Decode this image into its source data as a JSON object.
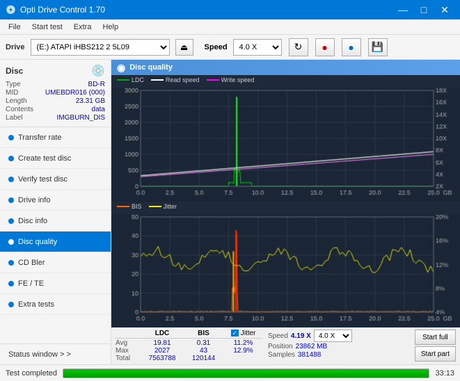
{
  "titleBar": {
    "title": "Opti Drive Control 1.70",
    "controls": [
      "—",
      "□",
      "✕"
    ]
  },
  "menuBar": {
    "items": [
      "File",
      "Start test",
      "Extra",
      "Help"
    ]
  },
  "driveBar": {
    "label": "Drive",
    "driveValue": "(E:)  ATAPI iHBS212  2 5L09",
    "speedLabel": "Speed",
    "speedValue": "4.0 X"
  },
  "disc": {
    "title": "Disc",
    "fields": [
      {
        "label": "Type",
        "value": "BD-R"
      },
      {
        "label": "MID",
        "value": "UMEBDR016 (000)"
      },
      {
        "label": "Length",
        "value": "23.31 GB"
      },
      {
        "label": "Contents",
        "value": "data"
      },
      {
        "label": "Label",
        "value": "IMGBURN_DIS"
      }
    ]
  },
  "nav": {
    "items": [
      {
        "label": "Transfer rate",
        "active": false
      },
      {
        "label": "Create test disc",
        "active": false
      },
      {
        "label": "Verify test disc",
        "active": false
      },
      {
        "label": "Drive info",
        "active": false
      },
      {
        "label": "Disc info",
        "active": false
      },
      {
        "label": "Disc quality",
        "active": true
      },
      {
        "label": "CD Bler",
        "active": false
      },
      {
        "label": "FE / TE",
        "active": false
      },
      {
        "label": "Extra tests",
        "active": false
      }
    ],
    "statusWindow": "Status window > >"
  },
  "chartTitle": "Disc quality",
  "upperChart": {
    "legend": [
      {
        "label": "LDC",
        "color": "#00aa00"
      },
      {
        "label": "Read speed",
        "color": "#ffffff"
      },
      {
        "label": "Write speed",
        "color": "#ff00ff"
      }
    ],
    "yAxisLeft": [
      "3000",
      "2500",
      "2000",
      "1500",
      "1000",
      "500",
      "0"
    ],
    "yAxisRight": [
      "18X",
      "16X",
      "14X",
      "12X",
      "10X",
      "8X",
      "6X",
      "4X",
      "2X"
    ],
    "xAxis": [
      "0.0",
      "2.5",
      "5.0",
      "7.5",
      "10.0",
      "12.5",
      "15.0",
      "17.5",
      "20.0",
      "22.5",
      "25.0 GB"
    ]
  },
  "lowerChart": {
    "legend": [
      {
        "label": "BIS",
        "color": "#ff6600"
      },
      {
        "label": "Jitter",
        "color": "#ffff00"
      }
    ],
    "yAxisLeft": [
      "50",
      "40",
      "30",
      "20",
      "10",
      "0"
    ],
    "yAxisRight": [
      "20%",
      "16%",
      "12%",
      "8%",
      "4%"
    ],
    "xAxis": [
      "0.0",
      "2.5",
      "5.0",
      "7.5",
      "10.0",
      "12.5",
      "15.0",
      "17.5",
      "20.0",
      "22.5",
      "25.0 GB"
    ]
  },
  "stats": {
    "columns": [
      "LDC",
      "BIS"
    ],
    "jitterLabel": "Jitter",
    "rows": [
      {
        "label": "Avg",
        "ldc": "19.81",
        "bis": "0.31",
        "jitter": "11.2%"
      },
      {
        "label": "Max",
        "ldc": "2027",
        "bis": "43",
        "jitter": "12.9%"
      },
      {
        "label": "Total",
        "ldc": "7563788",
        "bis": "120144",
        "jitter": ""
      }
    ],
    "speedLabel": "Speed",
    "speedValue": "4.19 X",
    "speedSelectValue": "4.0 X",
    "positionLabel": "Position",
    "positionValue": "23862 MB",
    "samplesLabel": "Samples",
    "samplesValue": "381488",
    "startFullBtn": "Start full",
    "startPartBtn": "Start part"
  },
  "statusBar": {
    "text": "Test completed",
    "progress": 100,
    "time": "33:13"
  }
}
